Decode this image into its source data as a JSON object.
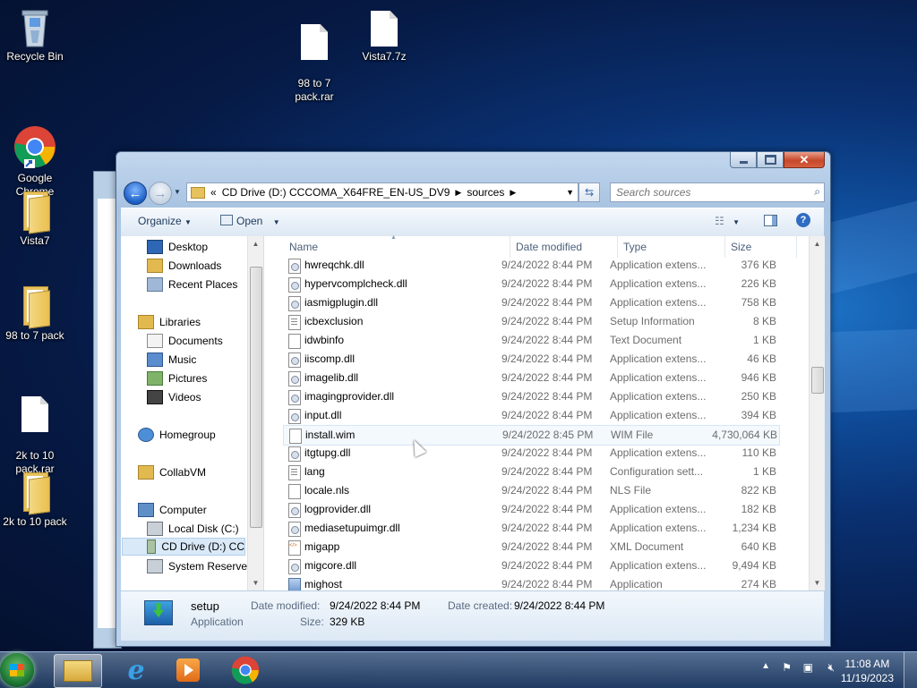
{
  "desktop": {
    "icons": [
      {
        "label": "Recycle Bin",
        "icon": "recycle-bin-icon"
      },
      {
        "label": "98 to 7\npack.rar",
        "icon": "file-icon"
      },
      {
        "label": "Vista7.7z",
        "icon": "file-icon"
      },
      {
        "label": "Google\nChrome",
        "icon": "chrome-icon"
      },
      {
        "label": "Vista7",
        "icon": "folder-icon"
      },
      {
        "label": "98 to 7 pack",
        "icon": "folder-icon"
      },
      {
        "label": "2k to 10\npack.rar",
        "icon": "file-icon"
      },
      {
        "label": "2k to 10 pack",
        "icon": "folder-icon"
      }
    ]
  },
  "explorer": {
    "address": {
      "prefix": "«",
      "segments": [
        "CD Drive (D:) CCCOMA_X64FRE_EN-US_DV9",
        "sources"
      ]
    },
    "search_placeholder": "Search sources",
    "toolbar": {
      "organize": "Organize",
      "open": "Open"
    },
    "nav": {
      "items": [
        {
          "label": "Desktop",
          "icon": "desktop-icon"
        },
        {
          "label": "Downloads",
          "icon": "downloads-icon"
        },
        {
          "label": "Recent Places",
          "icon": "recent-places-icon"
        },
        {
          "label": "Libraries",
          "icon": "libraries-icon"
        },
        {
          "label": "Documents",
          "icon": "documents-icon"
        },
        {
          "label": "Music",
          "icon": "music-icon"
        },
        {
          "label": "Pictures",
          "icon": "pictures-icon"
        },
        {
          "label": "Videos",
          "icon": "videos-icon"
        },
        {
          "label": "Homegroup",
          "icon": "homegroup-icon"
        },
        {
          "label": "CollabVM",
          "icon": "folder-icon"
        },
        {
          "label": "Computer",
          "icon": "computer-icon"
        },
        {
          "label": "Local Disk (C:)",
          "icon": "disk-icon"
        },
        {
          "label": "CD Drive (D:) CC",
          "icon": "cd-drive-icon"
        },
        {
          "label": "System Reserved",
          "icon": "disk-icon"
        }
      ]
    },
    "columns": {
      "name": "Name",
      "date": "Date modified",
      "type": "Type",
      "size": "Size"
    },
    "files": [
      {
        "name": "hwreqchk.dll",
        "date": "9/24/2022 8:44 PM",
        "type": "Application extens...",
        "size": "376 KB",
        "kind": "dll"
      },
      {
        "name": "hypervcomplcheck.dll",
        "date": "9/24/2022 8:44 PM",
        "type": "Application extens...",
        "size": "226 KB",
        "kind": "dll"
      },
      {
        "name": "iasmigplugin.dll",
        "date": "9/24/2022 8:44 PM",
        "type": "Application extens...",
        "size": "758 KB",
        "kind": "dll"
      },
      {
        "name": "icbexclusion",
        "date": "9/24/2022 8:44 PM",
        "type": "Setup Information",
        "size": "8 KB",
        "kind": "inf"
      },
      {
        "name": "idwbinfo",
        "date": "9/24/2022 8:44 PM",
        "type": "Text Document",
        "size": "1 KB",
        "kind": "txt"
      },
      {
        "name": "iiscomp.dll",
        "date": "9/24/2022 8:44 PM",
        "type": "Application extens...",
        "size": "46 KB",
        "kind": "dll"
      },
      {
        "name": "imagelib.dll",
        "date": "9/24/2022 8:44 PM",
        "type": "Application extens...",
        "size": "946 KB",
        "kind": "dll"
      },
      {
        "name": "imagingprovider.dll",
        "date": "9/24/2022 8:44 PM",
        "type": "Application extens...",
        "size": "250 KB",
        "kind": "dll"
      },
      {
        "name": "input.dll",
        "date": "9/24/2022 8:44 PM",
        "type": "Application extens...",
        "size": "394 KB",
        "kind": "dll"
      },
      {
        "name": "install.wim",
        "date": "9/24/2022 8:45 PM",
        "type": "WIM File",
        "size": "4,730,064 KB",
        "kind": "txt"
      },
      {
        "name": "itgtupg.dll",
        "date": "9/24/2022 8:44 PM",
        "type": "Application extens...",
        "size": "110 KB",
        "kind": "dll"
      },
      {
        "name": "lang",
        "date": "9/24/2022 8:44 PM",
        "type": "Configuration sett...",
        "size": "1 KB",
        "kind": "inf"
      },
      {
        "name": "locale.nls",
        "date": "9/24/2022 8:44 PM",
        "type": "NLS File",
        "size": "822 KB",
        "kind": "txt"
      },
      {
        "name": "logprovider.dll",
        "date": "9/24/2022 8:44 PM",
        "type": "Application extens...",
        "size": "182 KB",
        "kind": "dll"
      },
      {
        "name": "mediasetupuimgr.dll",
        "date": "9/24/2022 8:44 PM",
        "type": "Application extens...",
        "size": "1,234 KB",
        "kind": "dll"
      },
      {
        "name": "migapp",
        "date": "9/24/2022 8:44 PM",
        "type": "XML Document",
        "size": "640 KB",
        "kind": "xml"
      },
      {
        "name": "migcore.dll",
        "date": "9/24/2022 8:44 PM",
        "type": "Application extens...",
        "size": "9,494 KB",
        "kind": "dll"
      },
      {
        "name": "mighost",
        "date": "9/24/2022 8:44 PM",
        "type": "Application",
        "size": "274 KB",
        "kind": "app"
      }
    ],
    "details": {
      "name": "setup",
      "type": "Application",
      "modified_label": "Date modified:",
      "modified_value": "9/24/2022 8:44 PM",
      "created_label": "Date created:",
      "created_value": "9/24/2022 8:44 PM",
      "size_label": "Size:",
      "size_value": "329 KB"
    }
  },
  "taskbar": {
    "time": "11:08 AM",
    "date": "11/19/2023"
  }
}
